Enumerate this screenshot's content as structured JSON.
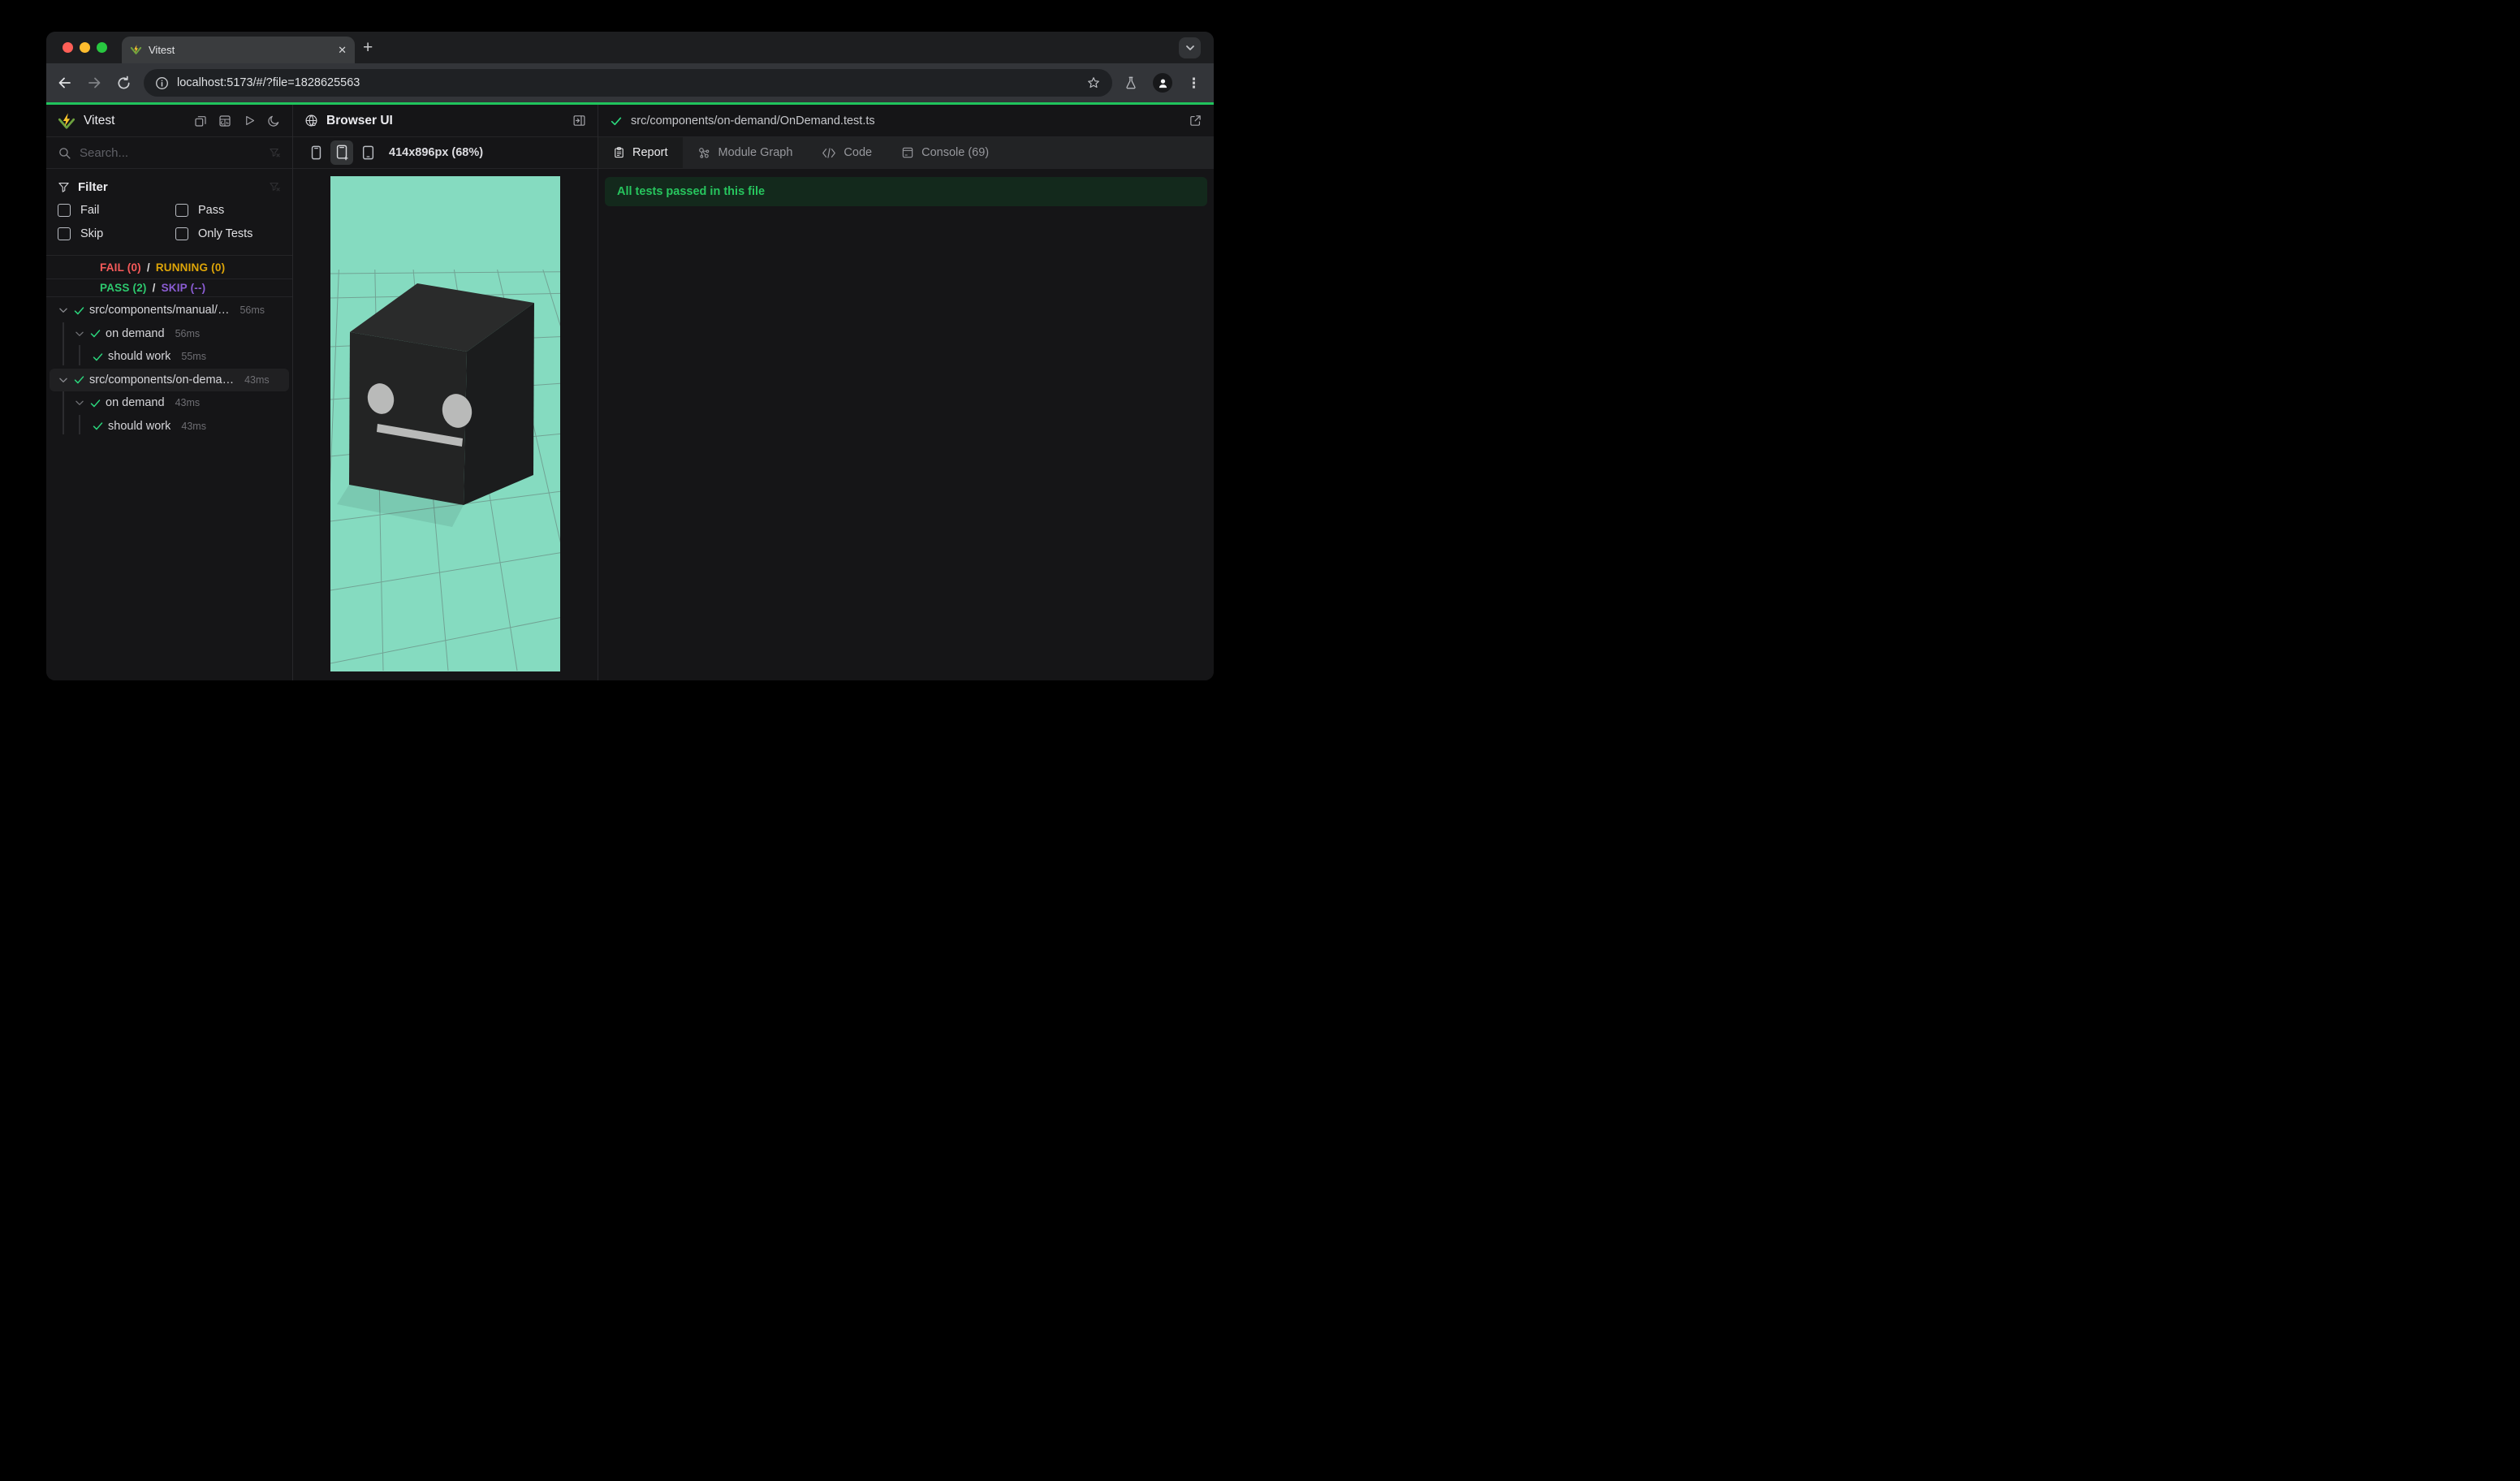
{
  "browser_chrome": {
    "tab_title": "Vitest",
    "close_tab_label": "✕",
    "new_tab_label": "+",
    "url": "localhost:5173/#/?file=1828625563"
  },
  "sidebar": {
    "app_title": "Vitest",
    "search_placeholder": "Search...",
    "filter": {
      "title": "Filter",
      "options": [
        "Fail",
        "Pass",
        "Skip",
        "Only Tests"
      ]
    },
    "summary": {
      "fail": "FAIL (0)",
      "sep1": "/",
      "running": "RUNNING (0)",
      "pass": "PASS (2)",
      "sep2": "/",
      "skip": "SKIP (--)"
    },
    "tree": [
      {
        "label": "src/components/manual/…",
        "duration": "56ms"
      },
      {
        "label": "on demand",
        "duration": "56ms"
      },
      {
        "label": "should work",
        "duration": "55ms"
      },
      {
        "label": "src/components/on-dema…",
        "duration": "43ms"
      },
      {
        "label": "on demand",
        "duration": "43ms"
      },
      {
        "label": "should work",
        "duration": "43ms"
      }
    ]
  },
  "browser_panel": {
    "title": "Browser UI",
    "viewport_label": "414x896px (68%)"
  },
  "report_panel": {
    "file_path": "src/components/on-demand/OnDemand.test.ts",
    "tabs": [
      {
        "label": "Report"
      },
      {
        "label": "Module Graph"
      },
      {
        "label": "Code"
      },
      {
        "label": "Console (69)"
      }
    ],
    "banner": "All tests passed in this file"
  },
  "colors": {
    "accent_green": "#20c45c",
    "fail_red": "#f65a5a",
    "running_yellow": "#dea508",
    "pass_green": "#2dc96e",
    "skip_purple": "#8b5cd3",
    "preview_background": "#85dbc0"
  }
}
